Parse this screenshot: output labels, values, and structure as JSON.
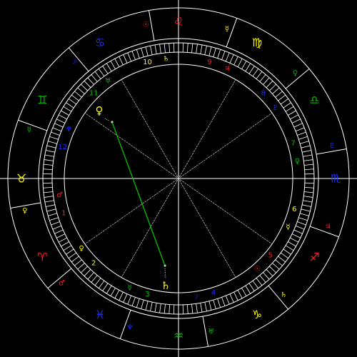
{
  "colors": {
    "background": "#000000",
    "line": "#ffffff",
    "aspect": "#00d000",
    "fire": "#ff2020",
    "earth": "#ffff00",
    "air": "#00c000",
    "water": "#2030ff"
  },
  "zodiac": [
    {
      "sign": "leo",
      "glyph": "♌",
      "ruler": "☉",
      "color": "#ff2020"
    },
    {
      "sign": "cancer",
      "glyph": "♋",
      "ruler": "☽",
      "color": "#2030ff"
    },
    {
      "sign": "gemini",
      "glyph": "♊",
      "ruler": "☿",
      "color": "#00c000"
    },
    {
      "sign": "taurus",
      "glyph": "♉",
      "ruler": "♀",
      "color": "#ffff00"
    },
    {
      "sign": "aries",
      "glyph": "♈",
      "ruler": "♂",
      "color": "#ff2020"
    },
    {
      "sign": "pisces",
      "glyph": "♓",
      "ruler": "♆",
      "color": "#2030ff"
    },
    {
      "sign": "aquarius",
      "glyph": "♒",
      "ruler": "♅",
      "color": "#00c000"
    },
    {
      "sign": "capricorn",
      "glyph": "♑",
      "ruler": "♄",
      "color": "#ffff00"
    },
    {
      "sign": "sagittarius",
      "glyph": "♐",
      "ruler": "♃",
      "color": "#ff2020"
    },
    {
      "sign": "scorpio",
      "glyph": "♏",
      "ruler": "♇",
      "color": "#2030ff"
    },
    {
      "sign": "libra",
      "glyph": "♎",
      "ruler": "♀",
      "color": "#00c000"
    },
    {
      "sign": "virgo",
      "glyph": "♍",
      "ruler": "☿",
      "color": "#ffff00"
    }
  ],
  "houses": [
    {
      "number": "1",
      "ruler": "♂",
      "color": "#ff2020"
    },
    {
      "number": "2",
      "ruler": "♀",
      "color": "#ffff00"
    },
    {
      "number": "3",
      "ruler": "☿",
      "color": "#00c000"
    },
    {
      "number": "4",
      "ruler": "☽",
      "color": "#2030ff"
    },
    {
      "number": "5",
      "ruler": "☉",
      "color": "#ff2020"
    },
    {
      "number": "6",
      "ruler": "☿",
      "color": "#ffff00"
    },
    {
      "number": "7",
      "ruler": "♀",
      "color": "#00c000"
    },
    {
      "number": "8",
      "ruler": "♇",
      "color": "#2030ff"
    },
    {
      "number": "9",
      "ruler": "♃",
      "color": "#ff2020"
    },
    {
      "number": "10",
      "ruler": "♄",
      "color": "#ffff00"
    },
    {
      "number": "11",
      "ruler": "♅",
      "color": "#00c000"
    },
    {
      "number": "12",
      "ruler": "♆",
      "color": "#2030ff"
    }
  ],
  "planets": [
    {
      "name": "venus",
      "glyph": "♀",
      "color": "#ffff00"
    },
    {
      "name": "saturn",
      "glyph": "♄",
      "color": "#ffff00"
    }
  ],
  "aspect": {
    "from": "venus",
    "to": "saturn",
    "type": "opposition"
  }
}
